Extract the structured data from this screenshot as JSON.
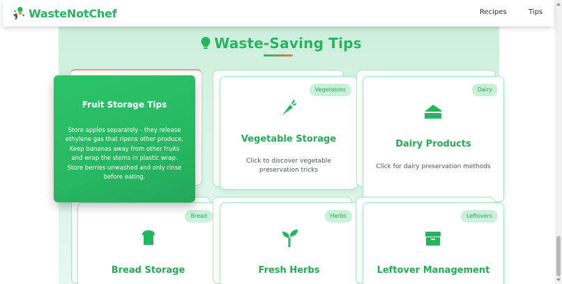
{
  "brand": {
    "name": "WasteNotChef"
  },
  "nav": {
    "links": [
      "Recipes",
      "Tips"
    ]
  },
  "section": {
    "title": "Waste-Saving Tips"
  },
  "flipped_card": {
    "title": "Fruit Storage Tips",
    "text": "Store apples separately - they release ethylene gas that ripens other produce. Keep bananas away from other fruits and wrap the stems in plastic wrap. Store berries unwashed and only rinse before eating."
  },
  "cards": [
    {
      "badge": "Vegetables",
      "title": "Vegetable Storage",
      "description": "Click to discover vegetable preservation tricks",
      "icon": "carrot-icon"
    },
    {
      "badge": "Dairy",
      "title": "Dairy Products",
      "description": "Click for dairy preservation methods",
      "icon": "cheese-icon"
    },
    {
      "badge": "Bread",
      "title": "Bread Storage",
      "description": "",
      "icon": "bread-icon"
    },
    {
      "badge": "Herbs",
      "title": "Fresh Herbs",
      "description": "",
      "icon": "seedling-icon"
    },
    {
      "badge": "Leftovers",
      "title": "Leftover Management",
      "description": "",
      "icon": "box-icon"
    }
  ],
  "colors": {
    "brand_green": "#27b45f",
    "accent_coral": "#e07a55",
    "badge_bg": "#c9f0d9"
  }
}
